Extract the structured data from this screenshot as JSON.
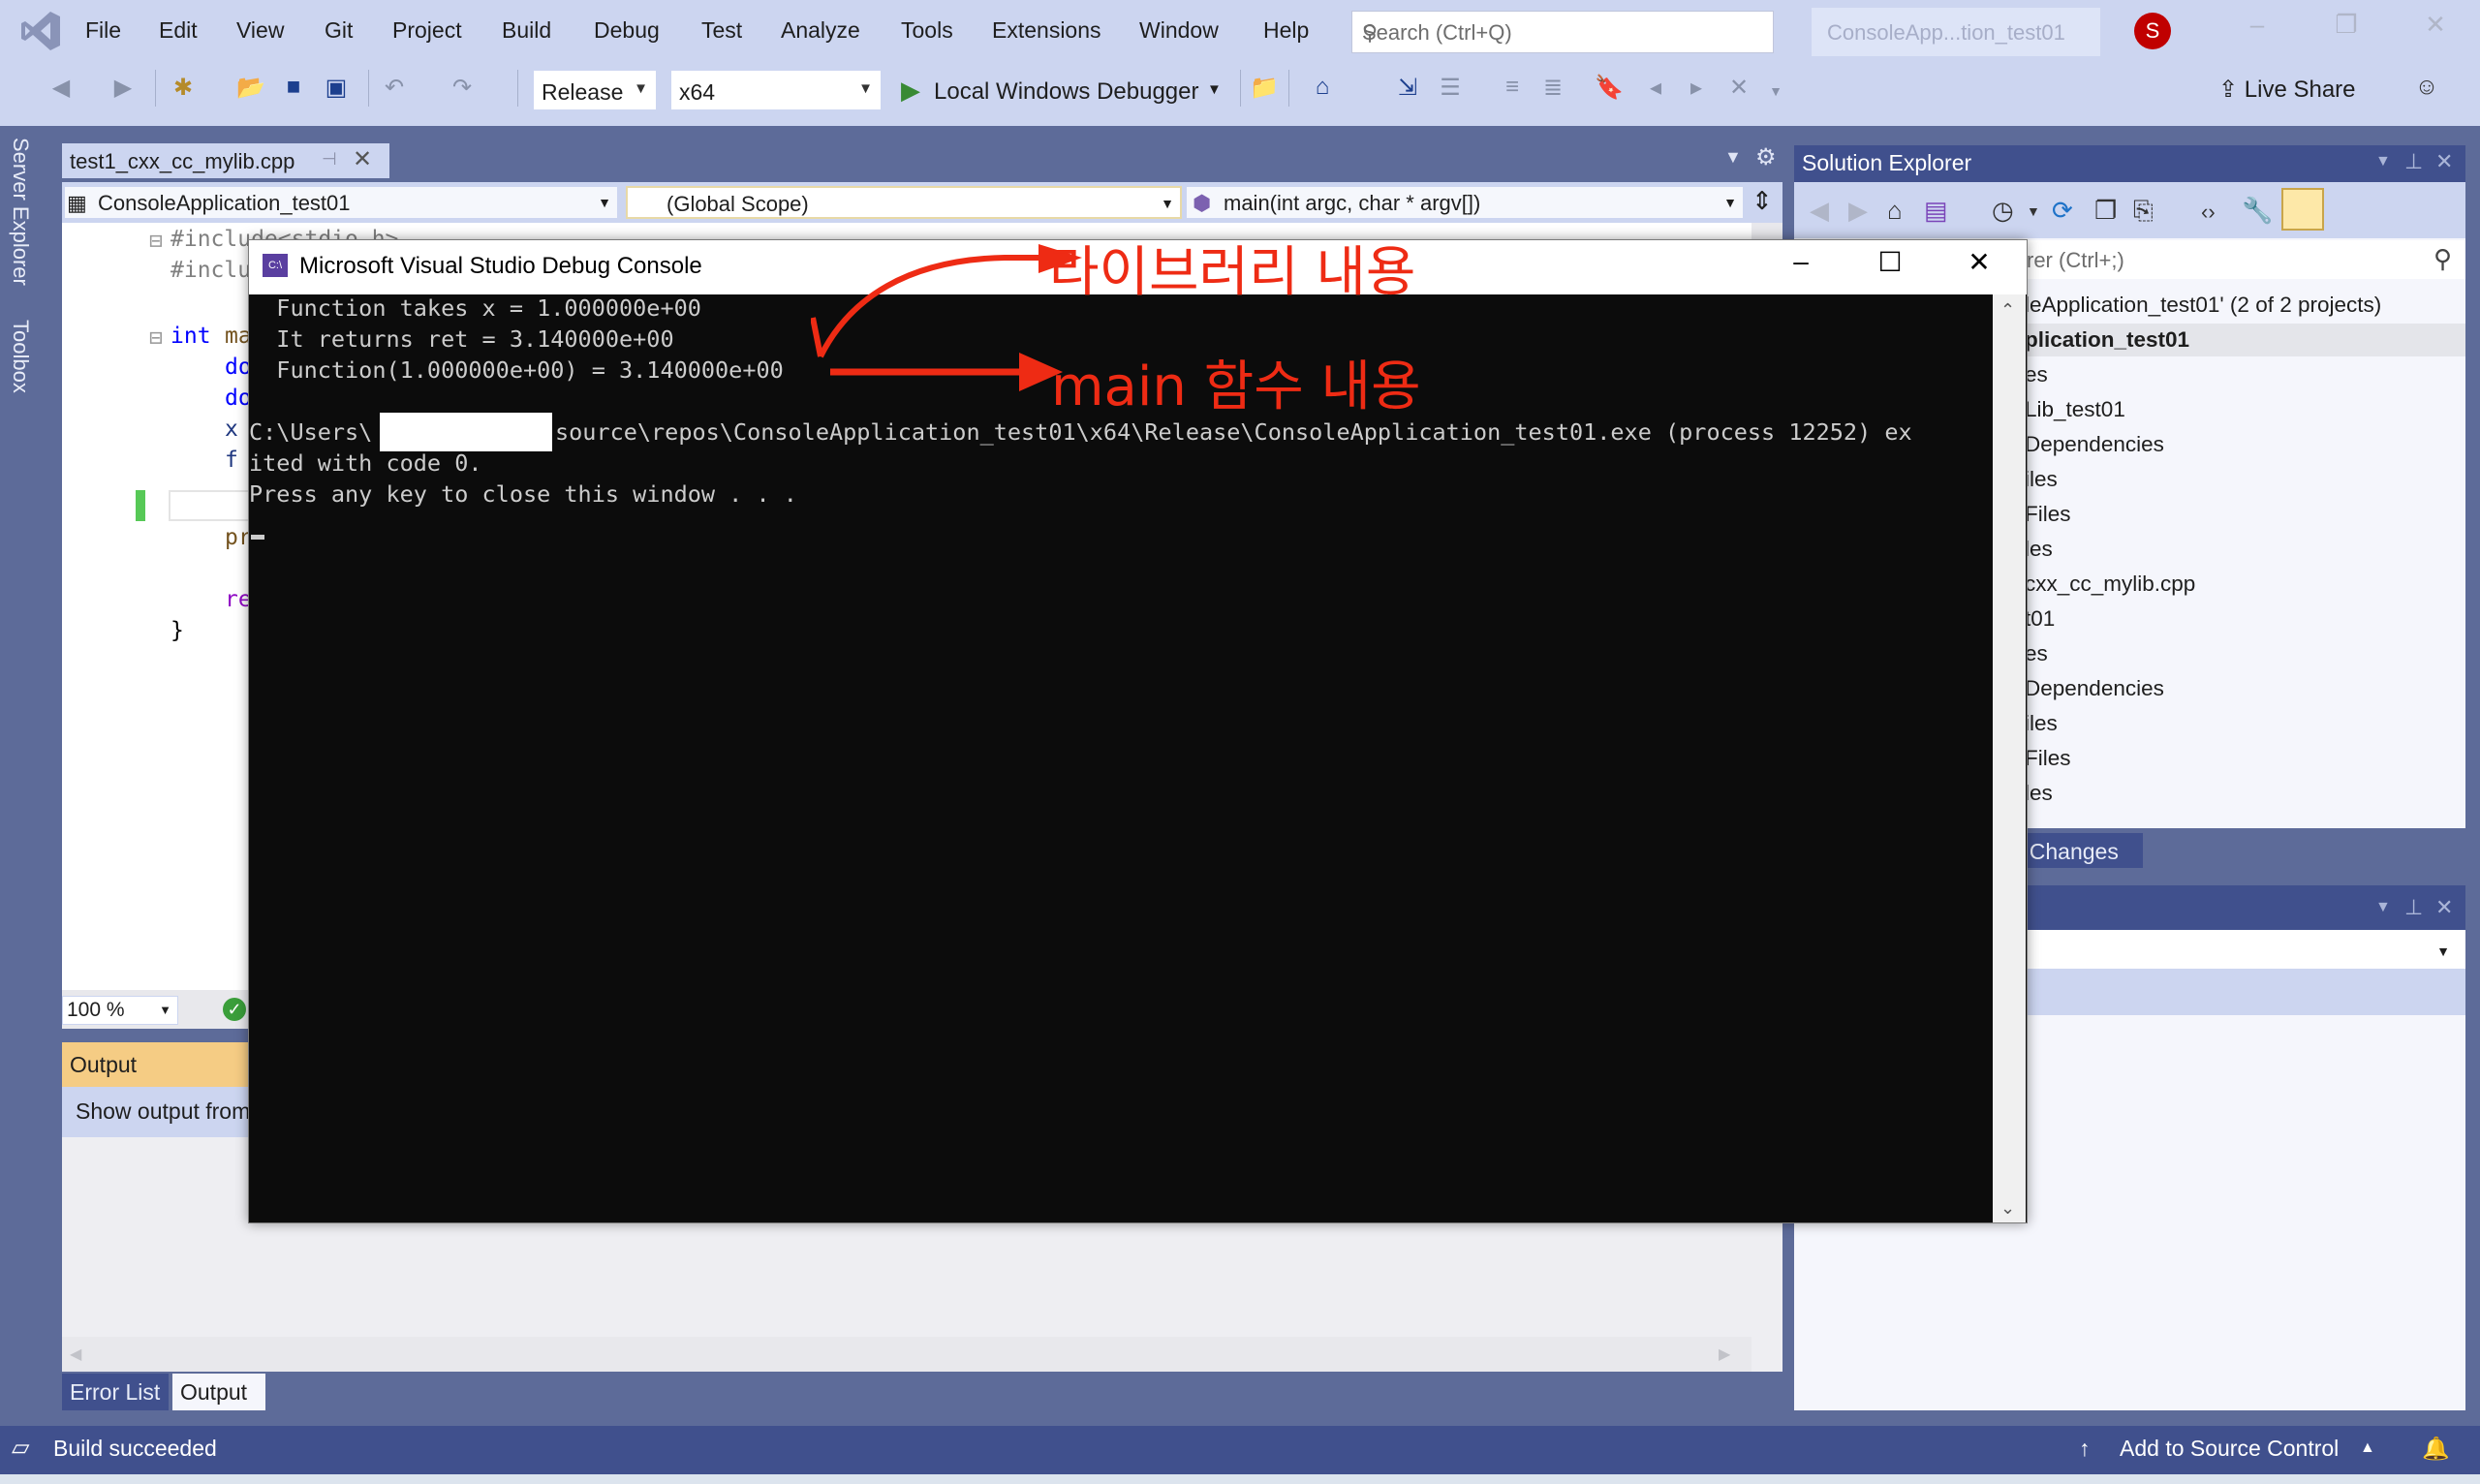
{
  "titlebar": {
    "menu": [
      "File",
      "Edit",
      "View",
      "Git",
      "Project",
      "Build",
      "Debug",
      "Test",
      "Analyze",
      "Tools",
      "Extensions",
      "Window",
      "Help"
    ],
    "search_placeholder": "Search (Ctrl+Q)",
    "solution_name": "ConsoleApp...tion_test01",
    "avatar_initial": "S",
    "window_controls": {
      "minimize": "–",
      "restore": "❐",
      "close": "✕"
    }
  },
  "toolbar": {
    "configuration": "Release",
    "platform": "x64",
    "run_label": "Local Windows Debugger",
    "live_share": "Live Share"
  },
  "left_strip": {
    "tabs": [
      "Server Explorer",
      "Toolbox"
    ]
  },
  "editor": {
    "tab_name": "test1_cxx_cc_mylib.cpp",
    "project_combo": "ConsoleApplication_test01",
    "scope_combo": "(Global Scope)",
    "member_combo": "main(int argc, char * argv[])",
    "code_fragments": {
      "include1": "#include<stdio.h>",
      "include2": "#inclu",
      "main_kw": "int",
      "main_name": "ma",
      "l1": "do",
      "l2": "do",
      "l3": "x",
      "l4": "f",
      "l5": "pr",
      "l6": "re",
      "close": "}"
    },
    "zoom": "100 %"
  },
  "output": {
    "title": "Output",
    "show_output_from": "Show output from:",
    "tabs": [
      "Error List",
      "Output"
    ],
    "active_tab": "Output"
  },
  "console": {
    "title": "Microsoft Visual Studio Debug Console",
    "lines": [
      "  Function takes x = 1.000000e+00",
      "  It returns ret = 3.140000e+00",
      "  Function(1.000000e+00) = 3.140000e+00",
      "",
      "C:\\Users\\          source\\repos\\ConsoleApplication_test01\\x64\\Release\\ConsoleApplication_test01.exe (process 12252) ex",
      "ited with code 0.",
      "Press any key to close this window . . ."
    ],
    "path_prefix": "C:\\Users\\",
    "path_suffix": "source\\repos\\ConsoleApplication_test01\\x64\\Release\\ConsoleApplication_test01.exe (process 12252) ex",
    "annotations": {
      "library": "라이브러리 내용",
      "main": "main 함수 내용"
    },
    "annotation_color": "#ee2b14"
  },
  "solution_explorer": {
    "title": "Solution Explorer",
    "search_placeholder": "rer (Ctrl+;)",
    "rows": [
      {
        "text": "leApplication_test01' (2 of 2 projects)",
        "bold": false
      },
      {
        "text": "plication_test01",
        "bold": true
      },
      {
        "text": "es",
        "bold": false
      },
      {
        "text": "Lib_test01",
        "bold": false
      },
      {
        "text": "Dependencies",
        "bold": false
      },
      {
        "text": "iles",
        "bold": false
      },
      {
        "text": " Files",
        "bold": false
      },
      {
        "text": "les",
        "bold": false
      },
      {
        "text": "cxx_cc_mylib.cpp",
        "bold": false
      },
      {
        "text": "t01",
        "bold": false
      },
      {
        "text": "es",
        "bold": false
      },
      {
        "text": "Dependencies",
        "bold": false
      },
      {
        "text": "iles",
        "bold": false
      },
      {
        "text": " Files",
        "bold": false
      },
      {
        "text": "les",
        "bold": false
      }
    ],
    "git_changes_tab": "t Changes"
  },
  "statusbar": {
    "build_status": "Build succeeded",
    "source_control": "Add to Source Control"
  },
  "colors": {
    "chrome": "#ccd5f0",
    "frame": "#5d6b99",
    "accent_dark": "#40508d",
    "output_header": "#f5cc84",
    "console_bg": "#0c0c0c"
  }
}
